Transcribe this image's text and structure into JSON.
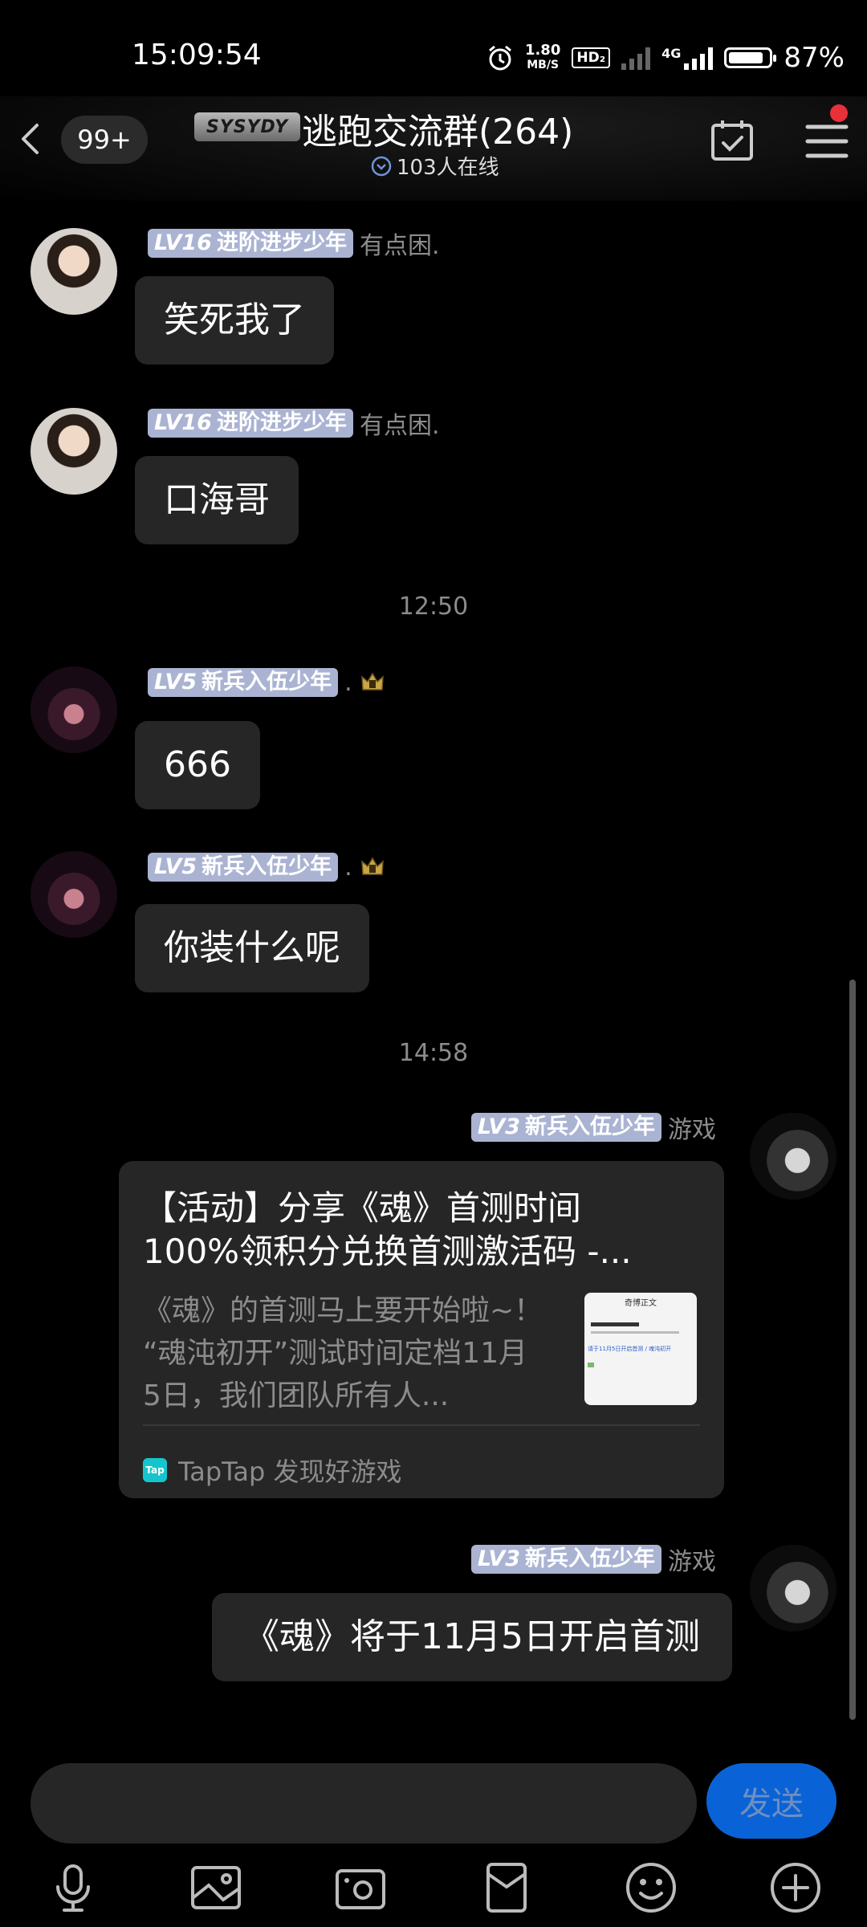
{
  "status_bar": {
    "time": "15:09:54",
    "net_speed_value": "1.80",
    "net_speed_unit": "MB/S",
    "hd_label": "HD₂",
    "network_label": "4G",
    "battery": "87%",
    "battery_level": 0.87
  },
  "header": {
    "unread_count": "99+",
    "logo_text": "SYSYDY",
    "title": "逃跑交流群(264)",
    "online": "103人在线"
  },
  "messages": [
    {
      "level": "LV16",
      "rank": "进阶进步少年",
      "nickname": "有点困.",
      "text": "笑死我了"
    },
    {
      "level": "LV16",
      "rank": "进阶进步少年",
      "nickname": "有点困.",
      "text": "口海哥"
    },
    {
      "level": "LV5",
      "rank": "新兵入伍少年",
      "nickname": ".",
      "text": "666"
    },
    {
      "level": "LV5",
      "rank": "新兵入伍少年",
      "nickname": ".",
      "text": "你装什么呢"
    },
    {
      "level": "LV3",
      "rank": "新兵入伍少年",
      "nickname": "游戏"
    },
    {
      "level": "LV3",
      "rank": "新兵入伍少年",
      "nickname": "游戏",
      "text": "《魂》将于11月5日开启首测"
    }
  ],
  "timestamps": [
    "12:50",
    "14:58"
  ],
  "link_card": {
    "title_line1": "【活动】分享《魂》首测时间",
    "title_line2": "100%领积分兑换首测激活码 -...",
    "desc_line1": "《魂》的首测马上要开始啦~！",
    "desc_line2": "“魂沌初开”测试时间定档11月",
    "desc_line3": "5日，我们团队所有人...",
    "thumb_heading": "奇博正文",
    "thumb_line": "请于11月5日开启首测 / 魂沌初开",
    "source_icon": "Tap",
    "source": "TapTap 发现好游戏"
  },
  "input": {
    "placeholder": "",
    "send_label": "发送"
  },
  "toolbar": [
    "mic-icon",
    "image-icon",
    "camera-icon",
    "red-packet-icon",
    "emoji-icon",
    "plus-icon"
  ],
  "colors": {
    "accent": "#0a63d6",
    "badge": "#aab3d2",
    "bubble": "#262626",
    "notification_dot": "#e8303a"
  }
}
